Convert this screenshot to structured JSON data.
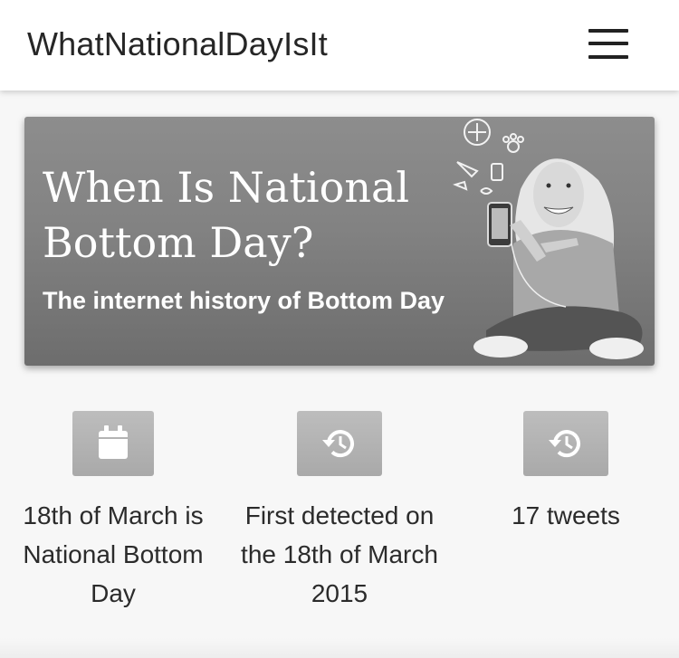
{
  "header": {
    "brand": "WhatNationalDayIsIt",
    "menu_icon": "hamburger-menu-icon"
  },
  "hero": {
    "title": "When Is National Bottom Day?",
    "subtitle": "The internet history of Bottom Day"
  },
  "features": [
    {
      "icon": "calendar-icon",
      "text": "18th of March is National Bottom Day"
    },
    {
      "icon": "history-icon",
      "text": "First detected on the 18th of March 2015"
    },
    {
      "icon": "history-icon",
      "text": "17 tweets"
    }
  ]
}
